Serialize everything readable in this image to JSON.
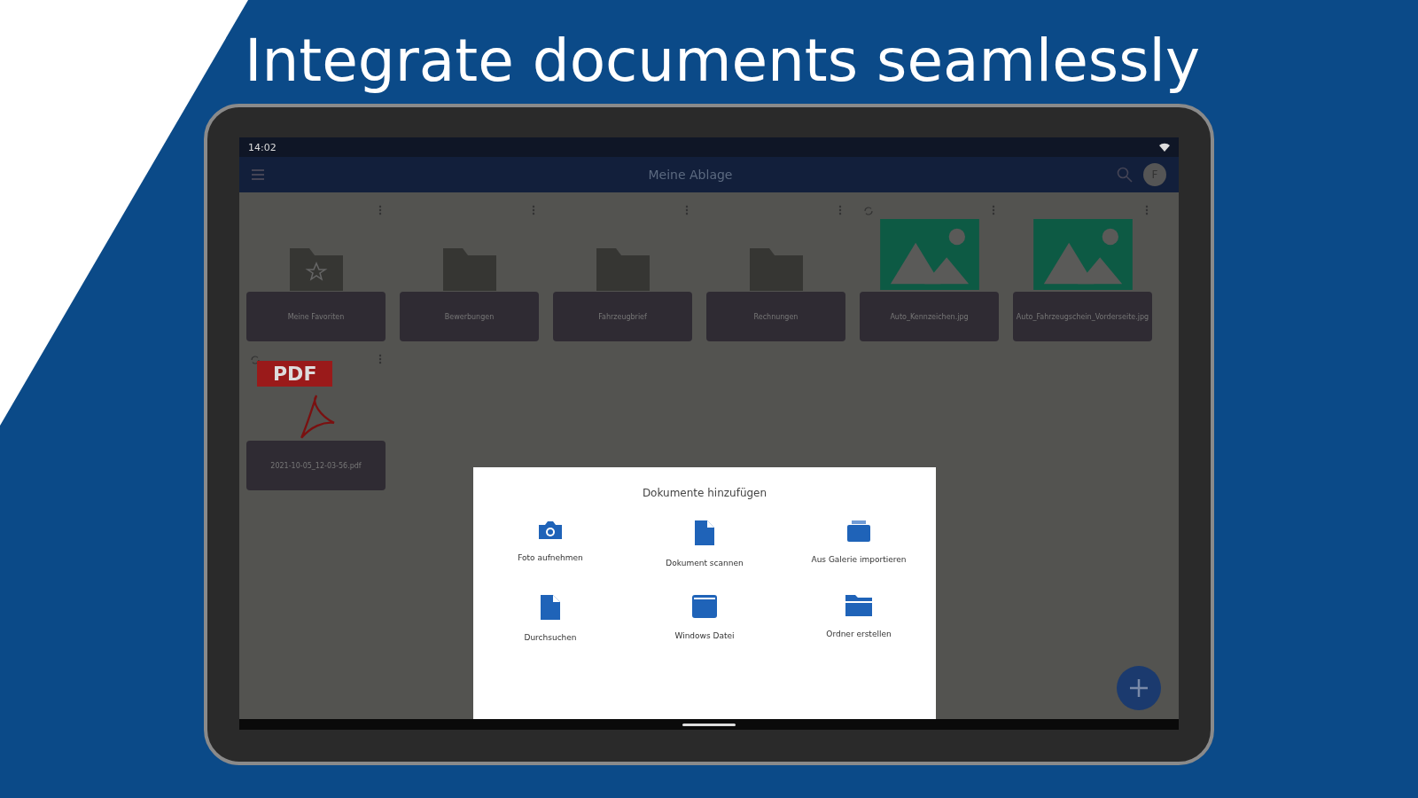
{
  "headline": "Integrate documents seamlessly",
  "status_bar": {
    "time": "14:02"
  },
  "app_bar": {
    "title": "Meine Ablage",
    "avatar": "F"
  },
  "items": [
    {
      "kind": "folder",
      "name": "Meine Favoriten",
      "starred": true
    },
    {
      "kind": "folder",
      "name": "Bewerbungen",
      "starred": false
    },
    {
      "kind": "folder",
      "name": "Fahrzeugbrief",
      "starred": false
    },
    {
      "kind": "folder",
      "name": "Rechnungen",
      "starred": false
    },
    {
      "kind": "image",
      "name": "Auto_Kennzeichen.jpg",
      "synced": true
    },
    {
      "kind": "image",
      "name": "Auto_Fahrzeugschein_Vorderseite.jpg",
      "synced": false
    },
    {
      "kind": "pdf",
      "name": "2021-10-05_12-03-56.pdf",
      "badge": "PDF",
      "synced": true
    }
  ],
  "dialog": {
    "title": "Dokumente hinzufügen",
    "actions": [
      {
        "kind": "camera",
        "label": "Foto aufnehmen"
      },
      {
        "kind": "document",
        "label": "Dokument scannen"
      },
      {
        "kind": "gallery",
        "label": "Aus Galerie importieren"
      },
      {
        "kind": "document",
        "label": "Durchsuchen"
      },
      {
        "kind": "window",
        "label": "Windows Datei"
      },
      {
        "kind": "folder",
        "label": "Ordner erstellen"
      }
    ]
  }
}
